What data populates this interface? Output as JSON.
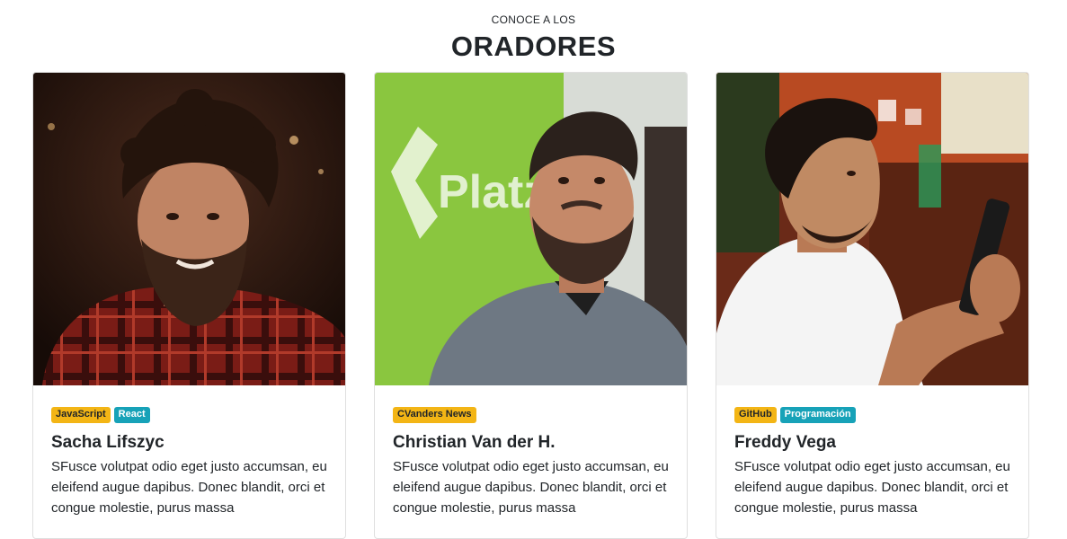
{
  "header": {
    "kicker": "CONOCE A LOS",
    "title": "ORADORES"
  },
  "speakers": [
    {
      "name": "Sacha Lifszyc",
      "tags": [
        {
          "label": "JavaScript",
          "color": "#f3b515"
        },
        {
          "label": "React",
          "color": "#17a2b8"
        }
      ],
      "description": "SFusce volutpat odio eget justo accumsan, eu eleifend augue dapibus. Donec blandit, orci et congue molestie, purus massa"
    },
    {
      "name": "Christian Van der H.",
      "tags": [
        {
          "label": "CVanders News",
          "color": "#f3b515"
        }
      ],
      "description": "SFusce volutpat odio eget justo accumsan, eu eleifend augue dapibus. Donec blandit, orci et congue molestie, purus massa"
    },
    {
      "name": "Freddy Vega",
      "tags": [
        {
          "label": "GitHub",
          "color": "#f3b515"
        },
        {
          "label": "Programación",
          "color": "#17a2b8"
        }
      ],
      "description": "SFusce volutpat odio eget justo accumsan, eu eleifend augue dapibus. Donec blandit, orci et congue molestie, purus massa"
    }
  ],
  "photo_logo_text": "Platzi"
}
